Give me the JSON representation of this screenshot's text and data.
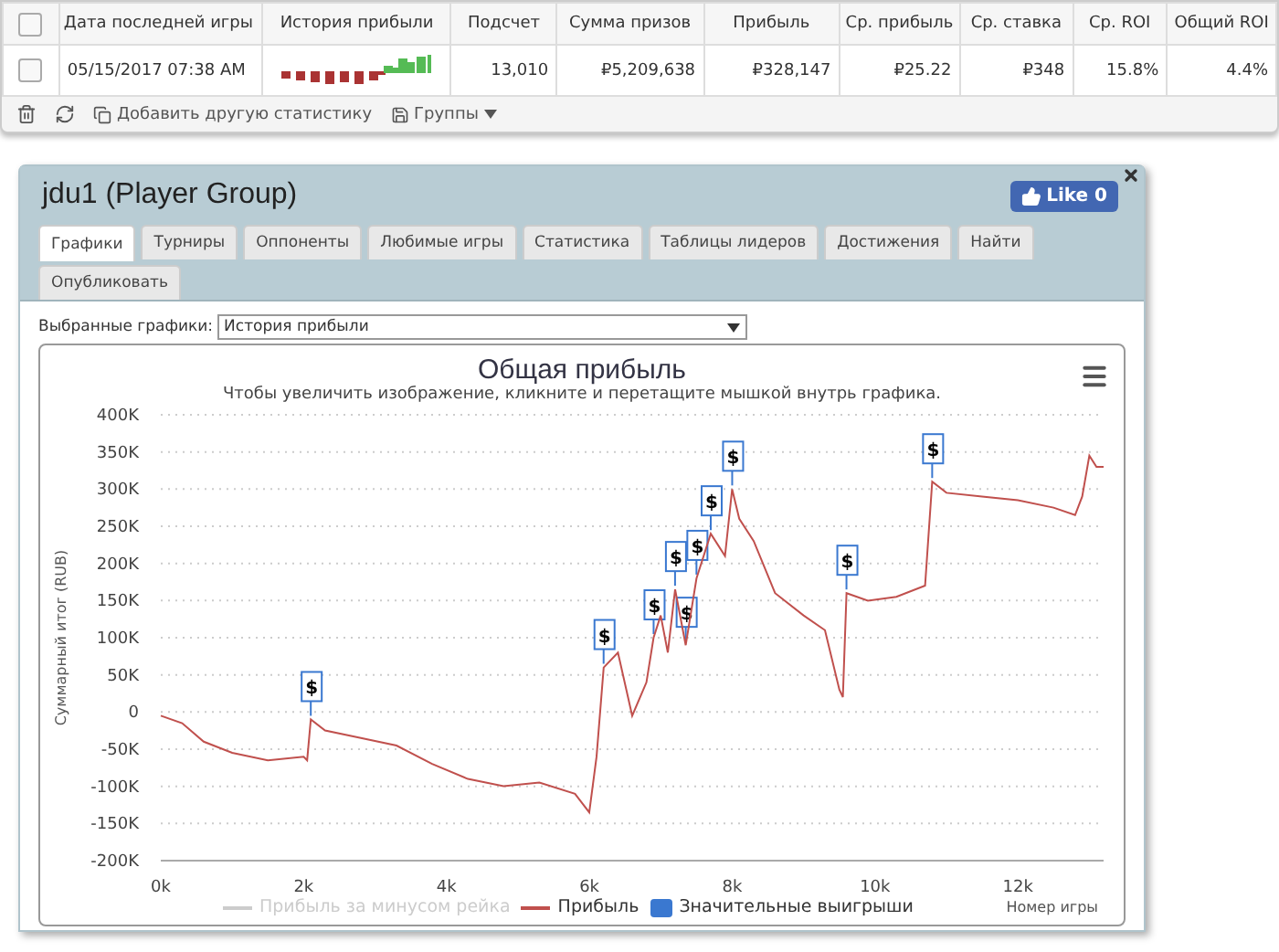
{
  "stats_table": {
    "all_checked": false,
    "columns": [
      {
        "label": "Дата последней игры"
      },
      {
        "label": "История прибыли"
      },
      {
        "label": "Подсчет"
      },
      {
        "label": "Сумма призов"
      },
      {
        "label": "Прибыль"
      },
      {
        "label": "Ср. прибыль"
      },
      {
        "label": "Ср. ставка"
      },
      {
        "label": "Ср. ROI"
      },
      {
        "label": "Общий ROI"
      }
    ],
    "rows": [
      {
        "checked": false,
        "date": "05/15/2017 07:38 AM",
        "count": "13,010",
        "prizes": "₽5,209,638",
        "profit": "₽328,147",
        "avg_profit": "₽25.22",
        "avg_stake": "₽348",
        "avg_roi": "15.8%",
        "total_roi": "4.4%"
      }
    ],
    "toolbar": {
      "add_label": "Добавить другую статистику",
      "groups_label": "Группы"
    }
  },
  "panel": {
    "title": "jdu1 (Player Group)",
    "like": {
      "label": "Like 0"
    },
    "tabs": [
      {
        "label": "Графики",
        "selected": true
      },
      {
        "label": "Турниры",
        "selected": false
      },
      {
        "label": "Оппоненты",
        "selected": false
      },
      {
        "label": "Любимые игры",
        "selected": false
      },
      {
        "label": "Статистика",
        "selected": false
      },
      {
        "label": "Таблицы лидеров",
        "selected": false
      },
      {
        "label": "Достижения",
        "selected": false
      },
      {
        "label": "Найти",
        "selected": false
      },
      {
        "label": "Опубликовать",
        "selected": false
      }
    ],
    "chart_select": {
      "label": "Выбранные графики:",
      "value": "История прибыли"
    },
    "chart": {
      "subtitle": "Чтобы увеличить изображение, кликните и перетащите мышкой внутрь графика.",
      "chart_data": {
        "type": "line",
        "title": "Общая прибыль",
        "xlabel": "Номер игры",
        "ylabel": "Суммарный итог (RUB)",
        "grid": true,
        "x": [
          0,
          300,
          600,
          1000,
          1500,
          2000,
          2050,
          2100,
          2300,
          2800,
          3300,
          3800,
          4300,
          4800,
          5300,
          5800,
          6000,
          6100,
          6200,
          6400,
          6600,
          6800,
          6900,
          7000,
          7100,
          7200,
          7350,
          7500,
          7700,
          7900,
          8000,
          8100,
          8300,
          8600,
          9000,
          9300,
          9500,
          9550,
          9600,
          9900,
          10300,
          10700,
          10800,
          11000,
          11500,
          12000,
          12500,
          12800,
          12900,
          13000,
          13100,
          13200
        ],
        "series": [
          {
            "name": "Прибыль",
            "color": "#c0504d",
            "values": [
              -5000,
              -15000,
              -40000,
              -55000,
              -65000,
              -60000,
              -65000,
              -10000,
              -25000,
              -35000,
              -45000,
              -70000,
              -90000,
              -100000,
              -95000,
              -110000,
              -135000,
              -60000,
              60000,
              80000,
              -5000,
              40000,
              100000,
              130000,
              80000,
              165000,
              90000,
              180000,
              240000,
              210000,
              300000,
              260000,
              230000,
              160000,
              130000,
              110000,
              30000,
              20000,
              160000,
              150000,
              155000,
              170000,
              310000,
              295000,
              290000,
              285000,
              275000,
              265000,
              290000,
              345000,
              330000,
              330000
            ]
          }
        ],
        "xlim": [
          0,
          13200
        ],
        "ylim": [
          -200000,
          400000
        ],
        "xticks": [
          {
            "value": 0,
            "label": "0k"
          },
          {
            "value": 2000,
            "label": "2k"
          },
          {
            "value": 4000,
            "label": "4k"
          },
          {
            "value": 6000,
            "label": "6k"
          },
          {
            "value": 8000,
            "label": "8k"
          },
          {
            "value": 10000,
            "label": "10k"
          },
          {
            "value": 12000,
            "label": "12k"
          }
        ],
        "yticks": [
          {
            "value": -200000,
            "label": "-200K"
          },
          {
            "value": -150000,
            "label": "-150K"
          },
          {
            "value": -100000,
            "label": "-100K"
          },
          {
            "value": -50000,
            "label": "-50K"
          },
          {
            "value": 0,
            "label": "0"
          },
          {
            "value": 50000,
            "label": "50K"
          },
          {
            "value": 100000,
            "label": "100K"
          },
          {
            "value": 150000,
            "label": "150K"
          },
          {
            "value": 200000,
            "label": "200K"
          },
          {
            "value": 250000,
            "label": "250K"
          },
          {
            "value": 300000,
            "label": "300K"
          },
          {
            "value": 350000,
            "label": "350K"
          },
          {
            "value": 400000,
            "label": "400K"
          }
        ],
        "annotations": [
          {
            "x": 2100,
            "text": "$"
          },
          {
            "x": 6200,
            "text": "$"
          },
          {
            "x": 6900,
            "text": "$"
          },
          {
            "x": 7200,
            "text": "$"
          },
          {
            "x": 7350,
            "text": "$"
          },
          {
            "x": 7500,
            "text": "$"
          },
          {
            "x": 7700,
            "text": "$"
          },
          {
            "x": 8000,
            "text": "$"
          },
          {
            "x": 9600,
            "text": "$"
          },
          {
            "x": 10800,
            "text": "$"
          }
        ]
      },
      "legend": [
        {
          "kind": "line",
          "label": "Прибыль за минусом рейка",
          "visible": false,
          "color": "#cccccc"
        },
        {
          "kind": "series",
          "visible": true
        },
        {
          "kind": "flag",
          "label": "Значительные выигрыши",
          "visible": true,
          "color": "#3a78d0"
        }
      ]
    }
  }
}
